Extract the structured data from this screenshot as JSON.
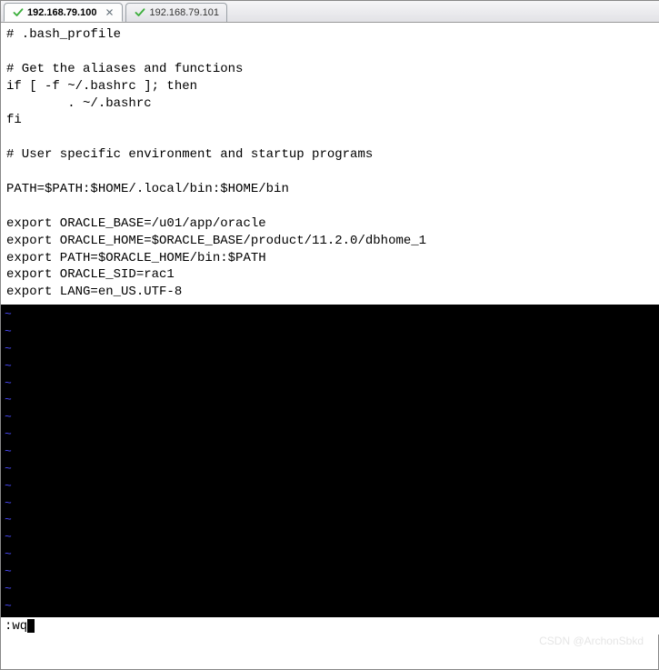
{
  "tabs": [
    {
      "label": "192.168.79.100",
      "active": true,
      "closable": true
    },
    {
      "label": "192.168.79.101",
      "active": false,
      "closable": false
    }
  ],
  "file_lines": [
    "# .bash_profile",
    "",
    "# Get the aliases and functions",
    "if [ -f ~/.bashrc ]; then",
    "        . ~/.bashrc",
    "fi",
    "",
    "# User specific environment and startup programs",
    "",
    "PATH=$PATH:$HOME/.local/bin:$HOME/bin",
    "",
    "export ORACLE_BASE=/u01/app/oracle",
    "export ORACLE_HOME=$ORACLE_BASE/product/11.2.0/dbhome_1",
    "export PATH=$ORACLE_HOME/bin:$PATH",
    "export ORACLE_SID=rac1",
    "export LANG=en_US.UTF-8"
  ],
  "tilde_lines": [
    "~",
    "~",
    "~",
    "~",
    "~",
    "~",
    "~",
    "~",
    "~",
    "~",
    "~",
    "~",
    "~",
    "~",
    "~",
    "~",
    "~",
    "~"
  ],
  "command_line": ":wq",
  "watermark": "CSDN @ArchonSbkd"
}
